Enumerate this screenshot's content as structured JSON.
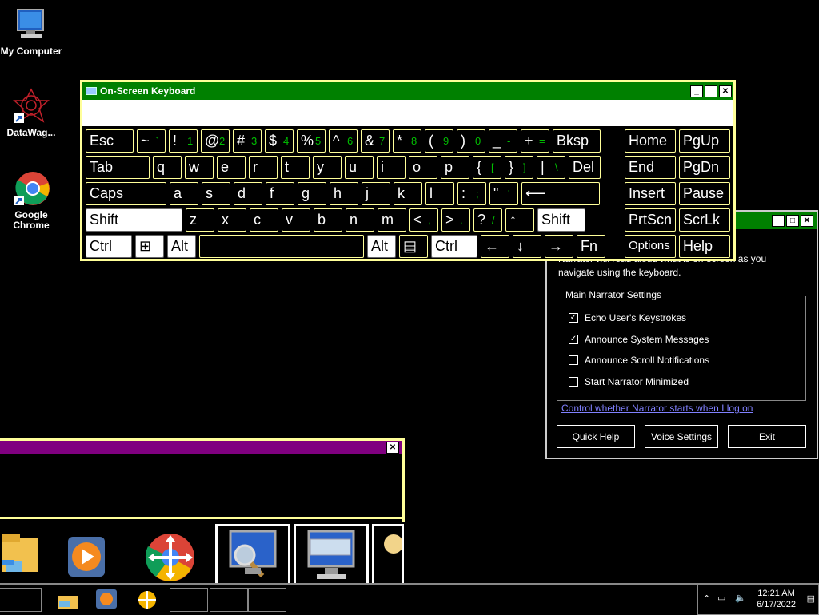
{
  "desktop": {
    "icons": [
      {
        "label": "My Computer"
      },
      {
        "label": "DataWag..."
      },
      {
        "label": "Google Chrome"
      }
    ]
  },
  "osk": {
    "title": "On-Screen Keyboard",
    "row1": [
      {
        "main": "Esc"
      },
      {
        "main": "~",
        "sub": "`"
      },
      {
        "main": "!",
        "sub": "1"
      },
      {
        "main": "@",
        "sub": "2"
      },
      {
        "main": "#",
        "sub": "3"
      },
      {
        "main": "$",
        "sub": "4"
      },
      {
        "main": "%",
        "sub": "5"
      },
      {
        "main": "^",
        "sub": "6"
      },
      {
        "main": "&",
        "sub": "7"
      },
      {
        "main": "*",
        "sub": "8"
      },
      {
        "main": "(",
        "sub": "9"
      },
      {
        "main": ")",
        "sub": "0"
      },
      {
        "main": "_",
        "sub": "-"
      },
      {
        "main": "+",
        "sub": "="
      },
      {
        "main": "Bksp"
      },
      {
        "main": "Home"
      },
      {
        "main": "PgUp"
      }
    ],
    "row2": [
      {
        "main": "Tab"
      },
      {
        "main": "q"
      },
      {
        "main": "w"
      },
      {
        "main": "e"
      },
      {
        "main": "r"
      },
      {
        "main": "t"
      },
      {
        "main": "y"
      },
      {
        "main": "u"
      },
      {
        "main": "i"
      },
      {
        "main": "o"
      },
      {
        "main": "p"
      },
      {
        "main": "{",
        "sub": "["
      },
      {
        "main": "}",
        "sub": "]"
      },
      {
        "main": "|",
        "sub": "\\"
      },
      {
        "main": "Del"
      },
      {
        "main": "End"
      },
      {
        "main": "PgDn"
      }
    ],
    "row3": [
      {
        "main": "Caps"
      },
      {
        "main": "a"
      },
      {
        "main": "s"
      },
      {
        "main": "d"
      },
      {
        "main": "f"
      },
      {
        "main": "g"
      },
      {
        "main": "h"
      },
      {
        "main": "j"
      },
      {
        "main": "k"
      },
      {
        "main": "l"
      },
      {
        "main": ":",
        "sub": ";"
      },
      {
        "main": "\"",
        "sub": "'"
      },
      {
        "main": "⟵"
      },
      {
        "main": "Insert"
      },
      {
        "main": "Pause"
      }
    ],
    "row4": [
      {
        "main": "Shift"
      },
      {
        "main": "z"
      },
      {
        "main": "x"
      },
      {
        "main": "c"
      },
      {
        "main": "v"
      },
      {
        "main": "b"
      },
      {
        "main": "n"
      },
      {
        "main": "m"
      },
      {
        "main": "<",
        "sub": ","
      },
      {
        "main": ">",
        "sub": "."
      },
      {
        "main": "?",
        "sub": "/"
      },
      {
        "main": "↑"
      },
      {
        "main": "Shift"
      },
      {
        "main": "PrtScn"
      },
      {
        "main": "ScrLk"
      }
    ],
    "row5": [
      {
        "main": "Ctrl"
      },
      {
        "main": "⊞"
      },
      {
        "main": "Alt"
      },
      {
        "main": ""
      },
      {
        "main": "Alt"
      },
      {
        "main": "▤"
      },
      {
        "main": "Ctrl"
      },
      {
        "main": "←"
      },
      {
        "main": "↓"
      },
      {
        "main": "→"
      },
      {
        "main": "Fn"
      },
      {
        "main": "Options"
      },
      {
        "main": "Help"
      }
    ]
  },
  "narrator": {
    "intro_line1": "Narrator will read aloud what is on-screen as you",
    "intro_line2": "navigate using the keyboard.",
    "group_label": "Main Narrator Settings",
    "options": [
      {
        "label": "Echo User's Keystrokes",
        "checked": true
      },
      {
        "label": "Announce System Messages",
        "checked": true
      },
      {
        "label": "Announce Scroll Notifications",
        "checked": false
      },
      {
        "label": "Start Narrator Minimized",
        "checked": false
      }
    ],
    "link": "Control whether Narrator starts when I log on",
    "buttons": {
      "quick_help": "Quick Help",
      "voice_settings": "Voice Settings",
      "exit": "Exit"
    }
  },
  "taskbar": {
    "time": "12:21 AM",
    "date": "6/17/2022"
  },
  "colors": {
    "osk_title": "#008000",
    "switcher_title": "#800080",
    "key_border": "#ffff99",
    "sub_label": "#00c000",
    "link": "#8080ff"
  }
}
